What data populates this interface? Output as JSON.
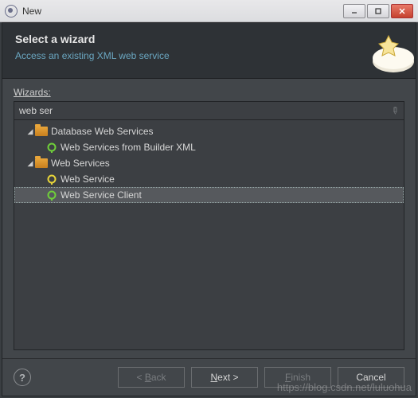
{
  "titlebar": {
    "title": "New"
  },
  "header": {
    "title": "Select a wizard",
    "subtitle": "Access an existing XML web service"
  },
  "body": {
    "wizards_label": "Wizards:",
    "filter_value": "web ser"
  },
  "tree": {
    "categories": [
      {
        "label": "Database Web Services",
        "items": [
          {
            "label": "Web Services from Builder XML",
            "color": "green",
            "selected": false
          }
        ]
      },
      {
        "label": "Web Services",
        "items": [
          {
            "label": "Web Service",
            "color": "yellow",
            "selected": false
          },
          {
            "label": "Web Service Client",
            "color": "green",
            "selected": true
          }
        ]
      }
    ]
  },
  "footer": {
    "back": "< Back",
    "next": "Next >",
    "finish": "Finish",
    "cancel": "Cancel"
  },
  "watermark": "https://blog.csdn.net/luluohua"
}
